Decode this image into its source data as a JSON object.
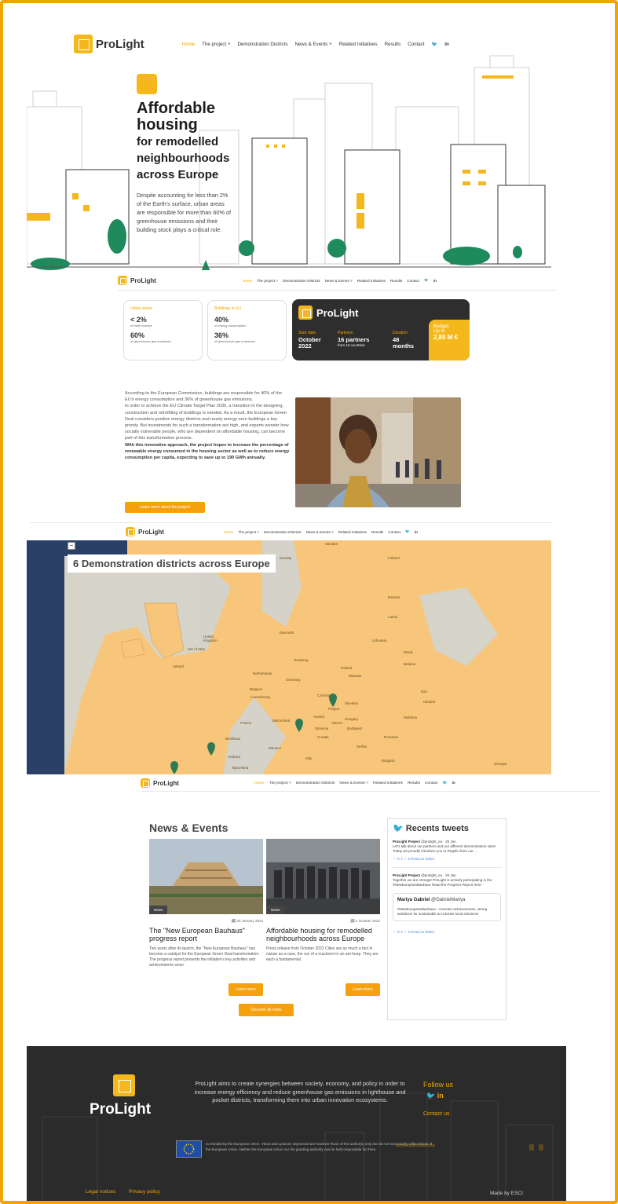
{
  "brand": {
    "name": "ProLight"
  },
  "nav": {
    "items": [
      "Home",
      "The project ˅",
      "Demonstration Districts",
      "News & Events ˅",
      "Related Initiatives",
      "Results",
      "Contact"
    ],
    "social": [
      "twitter-icon",
      "linkedin-icon"
    ]
  },
  "hero": {
    "title_line1": "Affordable",
    "title_line2": "housing",
    "title_line3": "for remodelled",
    "title_line4": "neighbourhoods",
    "title_line5": "across Europe",
    "paragraph": "Despite accounting for less than 2% of the Earth's surface, urban areas are responsible for more than 60% of greenhouse emissions and their building stock plays a critical role."
  },
  "stats": {
    "urban": {
      "label": "Urban areas",
      "v1": "< 2%",
      "d1": "of earth surface",
      "v2": "60%",
      "d2": "of greenhouse gas emissions"
    },
    "buildings": {
      "label": "Buildings in EU",
      "v1": "40%",
      "d1": "of energy consumption",
      "v2": "36%",
      "d2": "of greenhouse gas emissions"
    }
  },
  "project_card": {
    "brand": "ProLight",
    "start_label": "Start date:",
    "start_value": "October 2022",
    "partners_label": "Partners:",
    "partners_value": "16 partners",
    "partners_sub": "from 10 countries",
    "duration_label": "Duration:",
    "duration_value": "48 months",
    "budget_label": "Budget:",
    "budget_prefix": "Up to",
    "budget_value": "2,88 M €"
  },
  "about": {
    "p1": "According to the European Commission, buildings are responsible for 40% of the EU's energy consumption and 36% of greenhouse gas emissions.",
    "p2": "In order to achieve the EU Climate Target Plan 2030, a transition in the designing, construction and retrofitting of buildings is needed. As a result, the European Green Deal considers positive energy districts and nearly energy-zero buildings a key priority. But investments for such a transformation are high, and experts wonder how socially vulnerable people, who are dependent on affordable housing, can become part of this transformation process.",
    "p3": "With this innovative approach, the project hopes to increase the percentage of renewable energy consumed in the housing sector as well as to reduce energy consumption per capita, expecting to save up to 190 GWh annually.",
    "button": "Learn more about the project"
  },
  "map": {
    "title": "6 Demonstration districts across Europe",
    "zoom_button": "−",
    "labels": [
      "Sweden",
      "Norway",
      "Finland",
      "Estonia",
      "Latvia",
      "Lithuania",
      "Denmark",
      "United Kingdom",
      "Isle of Man",
      "Ireland",
      "Netherlands",
      "Belgium",
      "Germany",
      "Poland",
      "Belarus",
      "Luxembourg",
      "Czechia",
      "Slovakia",
      "Ukraine",
      "France",
      "Switzerland",
      "Austria",
      "Hungary",
      "Moldova",
      "Slovenia",
      "Croatia",
      "Romania",
      "Monaco",
      "Serbia",
      "Italy",
      "Bulgaria",
      "Andorra",
      "Georgia",
      "Barcelona",
      "Bordeaux",
      "Budapest",
      "Kyiv",
      "Minsk",
      "Warsaw",
      "Hamburg",
      "Prague",
      "Vienna"
    ]
  },
  "news": {
    "title": "News & Events",
    "cards": [
      {
        "tag": "News",
        "date": "20 January 2023",
        "title": "The \"New European Bauhaus\" progress report",
        "text": "Two years after its launch, the \"New European Bauhaus\" has become a catalyst for the European Green Deal transformation. The progress report presents the initiative's key activities and achievements since",
        "button": "Learn more"
      },
      {
        "tag": "News",
        "date": "4 October 2022",
        "title": "Affordable housing for remodelled neighbourhoods across Europe",
        "text": "Press release from October 2022 Cities are as much a fact in nature as a cave, the run of a mackerel or an ant heap. They are each a fundamental",
        "button": "Learn more"
      }
    ],
    "discover": "Discover all news"
  },
  "tweets": {
    "title": "Recents tweets",
    "items": [
      {
        "who": "ProLight Project",
        "handle": "@prolight_eu · 25 Jan",
        "text": "Let's talk about our partners and our different demonstration sites! Today we proudly introduce you to Regelio from our ...",
        "actions": "♡  ⟲ 4  ♡ 5    Read on twitter"
      },
      {
        "who": "ProLight Project",
        "handle": "@prolight_eu · 20 Jan",
        "text": "Together we are stronger ProLight is actively participating in the #NewEuropeanBauhaus Read the Progress Report here:",
        "actions": ""
      },
      {
        "who": "Mariya Gabriel",
        "handle": "@GabrielMariya",
        "text": "#NewEuropeanBauhaus - concrete achievements, strong ambitions for sustainable & inclusive local solutions!",
        "actions": "♡  ⟲ 4  ♡ 3    Read on twitter"
      }
    ]
  },
  "footer": {
    "brand": "ProLight",
    "text": "ProLight aims to create synergies between society, economy, and policy in order to increase energy efficiency and reduce greenhouse gas emissions in lighthouse and pocket districts, transforming them into urban innovation ecosystems.",
    "follow": "Follow us",
    "contact": "Contact us",
    "eu_text": "Co-funded by the European Union. Views and opinions expressed are however those of the author(s) only and do not necessarily reflect those of the European Union. Neither the European Union nor the granting authority can be held responsible for them.",
    "legal": "Legal notices",
    "privacy": "Privacy policy",
    "made_by": "Made by ESCI"
  },
  "colors": {
    "accent": "#f0a500",
    "dark": "#2b2b2b",
    "map": "#f7c67a",
    "green": "#1f8a5c"
  }
}
